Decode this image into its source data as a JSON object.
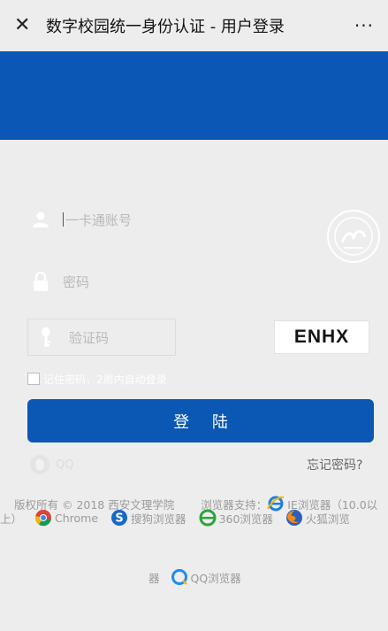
{
  "window": {
    "title": "数字校园统一身份认证 - 用户登录",
    "close_icon": "close-icon",
    "more_label": "···"
  },
  "colors": {
    "brand": "#0a57b6",
    "background": "#ededed",
    "placeholder": "#b9b9b9"
  },
  "form": {
    "account_placeholder": "一卡通账号",
    "password_placeholder": "密码",
    "captcha_placeholder": "验证码",
    "captcha_text": "ENHX",
    "remember_label": "记住密码，2周内自动登录",
    "login_label": "登 陆",
    "qq_label": "QQ",
    "forgot_label": "忘记密码?"
  },
  "footer": {
    "copyright": "版权所有 © 2018 西安文理学院",
    "browser_support": "浏览器支持：",
    "browsers": {
      "ie": "IE浏览器（10.0以",
      "ie_cont": "上）",
      "chrome": "Chrome",
      "sogou": "搜狗浏览器",
      "b360": "360浏览器",
      "firefox": "火狐浏览",
      "firefox_cont": "器",
      "qq": "QQ浏览器"
    }
  }
}
